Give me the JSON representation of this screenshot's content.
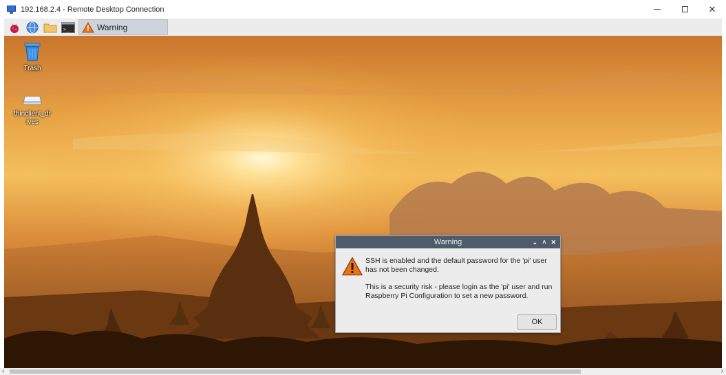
{
  "window": {
    "title": "192.168.2.4 - Remote Desktop Connection",
    "minimize_icon": "minimize-icon",
    "maximize_icon": "maximize-icon",
    "close_glyph": "✕"
  },
  "panel": {
    "apps": [
      "raspberry-menu-icon",
      "web-browser-icon",
      "file-manager-icon",
      "terminal-icon"
    ],
    "terminal_glyph": ">_",
    "task": {
      "label": "Warning",
      "icon": "warning-icon"
    }
  },
  "desktop": {
    "icons": [
      {
        "label": "Trash",
        "icon": "trash-icon"
      },
      {
        "label": "thinclient_drives",
        "icon": "drive-icon"
      }
    ]
  },
  "dialog": {
    "title": "Warning",
    "controls": [
      "⌄",
      "˄",
      "✕"
    ],
    "message_1": "SSH is enabled and the default password for the 'pi' user has not been changed.",
    "message_2": "This is a security risk - please login as the 'pi' user and run Raspberry Pi Configuration to set a new password.",
    "ok_label": "OK"
  },
  "scrollbar": {
    "left_arrow": "‹",
    "right_arrow": "›"
  },
  "colors": {
    "panel_bg": "#ececec",
    "dialog_title_bg": "#4d5b6b",
    "warning_orange": "#e8731c",
    "raspberry_red": "#c51a4a"
  }
}
